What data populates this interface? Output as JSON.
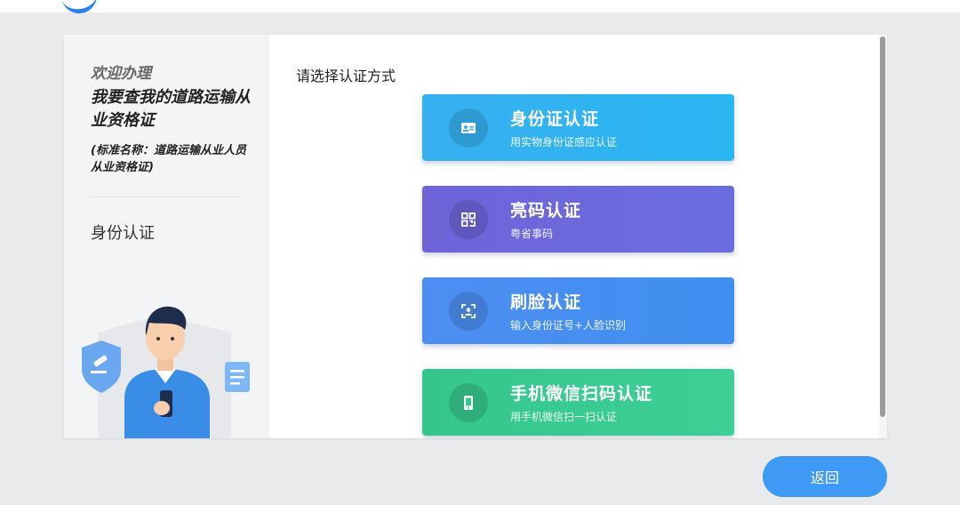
{
  "sidebar": {
    "welcome": "欢迎办理",
    "service_title": "我要查我的道路运输从业资格证",
    "standard_name": "(标准名称：道路运输从业人员从业资格证)",
    "current_step": "身份认证"
  },
  "main": {
    "title": "请选择认证方式",
    "methods": [
      {
        "title": "身份证认证",
        "subtitle": "用实物身份证感应认证",
        "icon": "id-card-icon",
        "color": "#38aff0"
      },
      {
        "title": "亮码认证",
        "subtitle": "粤省事码",
        "icon": "qr-code-icon",
        "color": "#6f63d8"
      },
      {
        "title": "刷脸认证",
        "subtitle": "输入身份证号+人脸识别",
        "icon": "face-scan-icon",
        "color": "#4e8ef2"
      },
      {
        "title": "手机微信扫码认证",
        "subtitle": "用手机微信扫一扫认证",
        "icon": "phone-icon",
        "color": "#35c68c"
      }
    ]
  },
  "footer": {
    "back_label": "返回"
  }
}
